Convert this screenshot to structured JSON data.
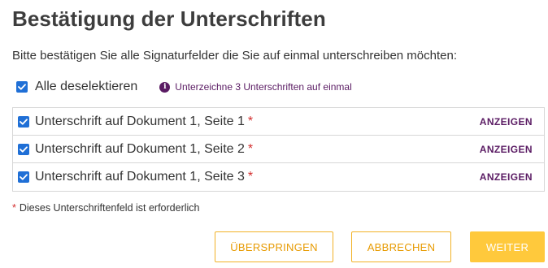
{
  "dialog": {
    "title": "Bestätigung der Unterschriften",
    "instruction": "Bitte bestätigen Sie alle Signaturfelder die Sie auf einmal unterschreiben möchten:"
  },
  "select_all": {
    "label": "Alle deselektieren",
    "checked": true,
    "info_text": "Unterzeichne 3 Unterschriften auf einmal"
  },
  "signatures": [
    {
      "label": "Unterschrift auf Dokument 1, Seite 1",
      "required_marker": "*",
      "action": "ANZEIGEN",
      "checked": true
    },
    {
      "label": "Unterschrift auf Dokument 1, Seite 2",
      "required_marker": "*",
      "action": "ANZEIGEN",
      "checked": true
    },
    {
      "label": "Unterschrift auf Dokument 1, Seite 3",
      "required_marker": "*",
      "action": "ANZEIGEN",
      "checked": true
    }
  ],
  "required_note": {
    "marker": "*",
    "text": "Dieses Unterschriftenfeld ist erforderlich"
  },
  "buttons": {
    "skip": "ÜBERSPRINGEN",
    "cancel": "ABBRECHEN",
    "next": "WEITER"
  },
  "colors": {
    "checkbox": "#1f6fd6",
    "accent_purple": "#5a1b63",
    "required_red": "#d32f2f",
    "button_orange": "#f2b227",
    "button_primary": "#ffc93c"
  },
  "icons": {
    "checkbox": "checkmark-icon",
    "info": "info-icon"
  }
}
